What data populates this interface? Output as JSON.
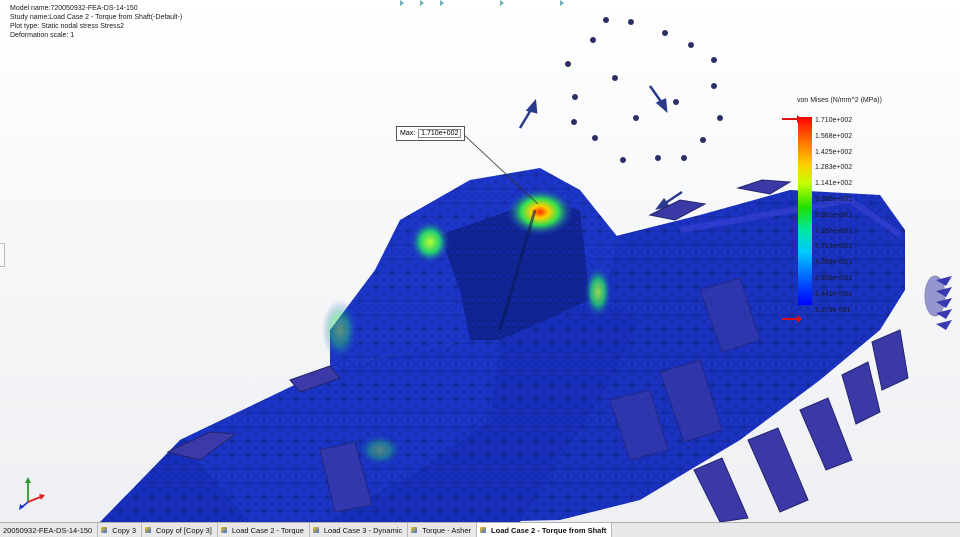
{
  "study_info": {
    "model_name": "Model name:720050932-FEA-DS-14-150",
    "study_name": "Study name:Load Case 2 - Torque from Shaft(-Default-)",
    "plot_type": "Plot type: Static nodal stress Stress2",
    "deformation_scale": "Deformation scale: 1"
  },
  "legend": {
    "title": "von Mises (N/mm^2 (MPa))",
    "ticks": [
      "1.710e+002",
      "1.568e+002",
      "1.425e+002",
      "1.283e+002",
      "1.141e+002",
      "9.985e+001",
      "8.561e+001",
      "7.137e+001",
      "5.713e+001",
      "4.289e+001",
      "2.865e+001",
      "1.441e+001",
      "1.673e-001"
    ],
    "max_color": "#ff0000",
    "min_color": "#0000ff"
  },
  "probe": {
    "label": "Max:",
    "value": "1.710e+002"
  },
  "part_colors": {
    "low_stress": "#1b33c9",
    "fixture_purple": "#3b3aa8",
    "mesh_line": "#0a0f3a"
  },
  "icons": {
    "load_arrow": "arrow-icon",
    "fixture": "fixture-arrow-icon",
    "triad": "axis-triad-icon"
  },
  "tabs": [
    {
      "label": "20050932-FEA-DS-14-150",
      "active": false
    },
    {
      "label": "Copy 3",
      "active": false
    },
    {
      "label": "Copy of [Copy 3]",
      "active": false
    },
    {
      "label": "Load Case 2 - Torque",
      "active": false
    },
    {
      "label": "Load Case 3 - Dynamic",
      "active": false
    },
    {
      "label": "Torque - Asher",
      "active": false
    },
    {
      "label": "Load Case 2 - Torque from Shaft",
      "active": true
    }
  ]
}
